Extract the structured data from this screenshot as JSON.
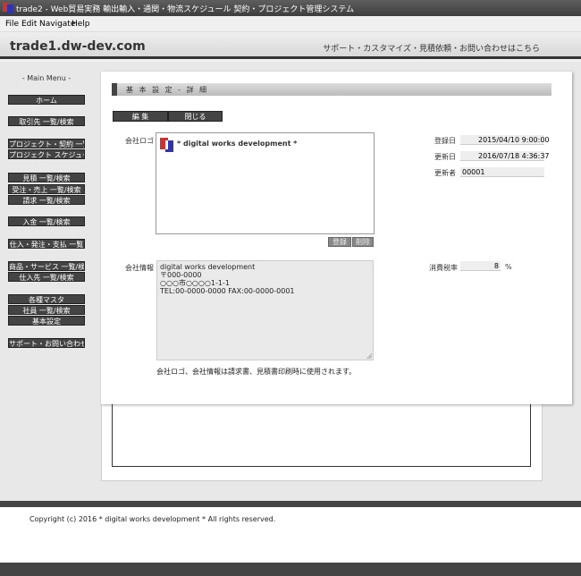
{
  "window": {
    "title": "trade2 - Web貿易実務 輸出輸入・通関・物流スケジュール 契約・プロジェクト管理システム"
  },
  "menubar": {
    "file": "File",
    "edit": "Edit",
    "navigate": "Navigate",
    "help": "Help"
  },
  "header": {
    "site": "trade1.dw-dev.com",
    "support_link": "サポート・カスタマイズ・見積依頼・お問い合わせはこちら"
  },
  "sidebar": {
    "title": "- Main Menu -",
    "items": [
      "ホーム",
      "取引先 一覧/検索",
      "プロジェクト・契約 一覧",
      "プロジェクト スケジュール",
      "見積 一覧/検索",
      "受注・売上 一覧/検索",
      "請求 一覧/検索",
      "入金 一覧/検索",
      "仕入・発注・支払 一覧",
      "商品・サービス 一覧/検索",
      "仕入先 一覧/検索",
      "各種マスタ",
      "社員 一覧/検索",
      "基本設定",
      "サポート・お問い合わせ"
    ]
  },
  "page": {
    "section_title": "基 本 設 定 - 詳 細",
    "edit_button": "編 集",
    "close_button": "閉じる",
    "logo_label": "会社ロゴ",
    "logo_text": "* digital works development *",
    "register_button": "登録",
    "delete_button": "削除",
    "registered_label": "登録日",
    "registered_value": "2015/04/10 9:00:00",
    "updated_label": "更新日",
    "updated_value": "2016/07/18 4:36:37",
    "updater_label": "更新者",
    "updater_value": "00001",
    "company_info_label": "会社情報",
    "company_info_lines": [
      "digital works development",
      "〒000-0000",
      "○○○市○○○○1-1-1",
      "TEL:00-0000-0000  FAX:00-0000-0001"
    ],
    "tax_label": "消費税率",
    "tax_value": "8",
    "tax_unit": "%",
    "note": "会社ロゴ、会社情報は請求書、見積書印刷時に使用されます。"
  },
  "footer": {
    "copyright": "Copyright (c) 2016 * digital works development * All rights reserved."
  },
  "colors": {
    "dark": "#444444",
    "panel": "#ffffff",
    "background": "#e8e8e8"
  }
}
